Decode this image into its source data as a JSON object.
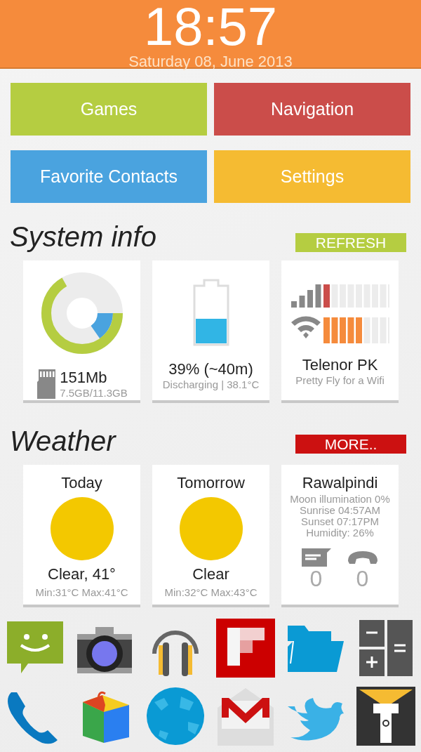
{
  "status_header": {
    "time": "18:57",
    "date": "Saturday 08, June 2013"
  },
  "shortcut_tiles": [
    {
      "label": "Games",
      "color": "#b5cd41"
    },
    {
      "label": "Navigation",
      "color": "#cb4d4a"
    },
    {
      "label": "Favorite Contacts",
      "color": "#4aa3df"
    },
    {
      "label": "Settings",
      "color": "#f5bb32"
    }
  ],
  "system_info": {
    "title": "System info",
    "action": "REFRESH",
    "storage": {
      "value": "151Mb",
      "detail": "7.5GB/11.3GB"
    },
    "battery": {
      "value": "39% (~40m)",
      "detail": "Discharging | 38.1°C"
    },
    "network": {
      "value": "Telenor PK",
      "detail": "Pretty Fly for a Wifi"
    }
  },
  "weather": {
    "title": "Weather",
    "action": "MORE..",
    "forecasts": [
      {
        "day": "Today",
        "condition": "Clear, 41°",
        "range": "Min:31°C Max:41°C"
      },
      {
        "day": "Tomorrow",
        "condition": "Clear",
        "range": "Min:32°C Max:43°C"
      }
    ],
    "location": {
      "city": "Rawalpindi",
      "lines": [
        "Moon illumination 0%",
        "Sunrise 04:57AM",
        "Sunset 07:17PM",
        "Humidity: 26%"
      ],
      "unread_messages": "0",
      "missed_calls": "0"
    }
  }
}
